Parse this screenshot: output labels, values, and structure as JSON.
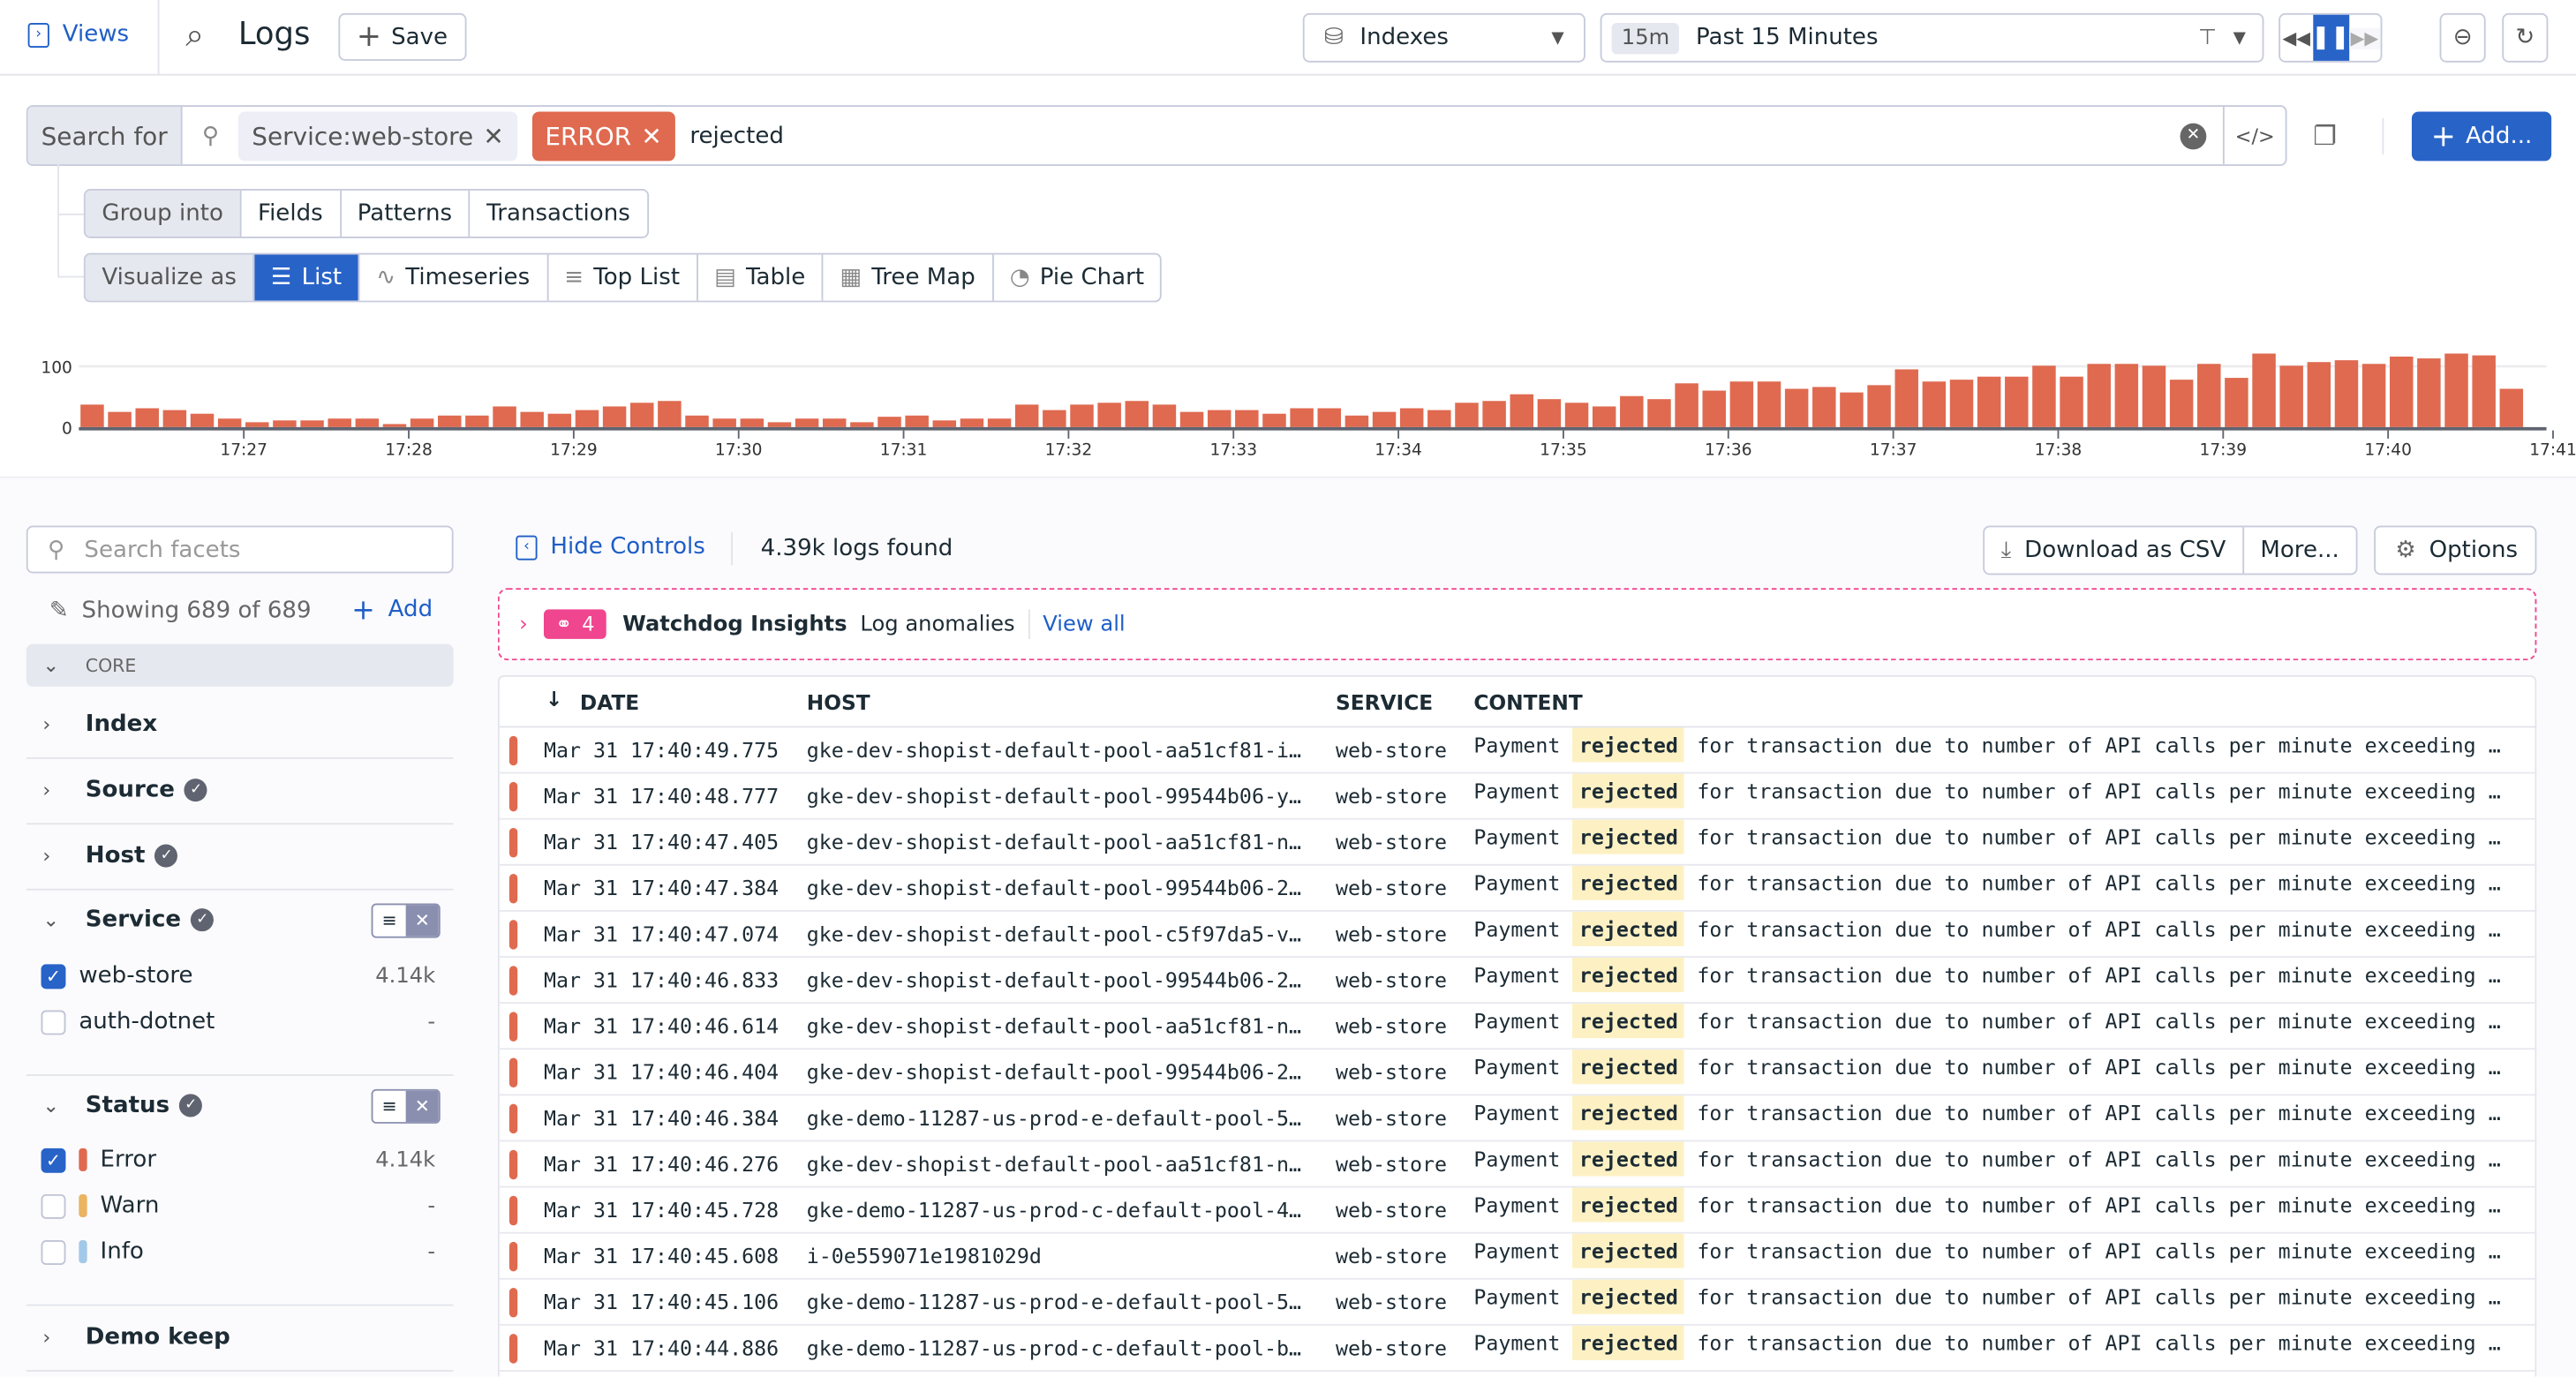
{
  "topbar": {
    "views": "Views",
    "title": "Logs",
    "save": "Save",
    "indexes": "Indexes",
    "time_badge": "15m",
    "time_range": "Past 15 Minutes"
  },
  "search": {
    "label": "Search for",
    "pills": [
      "Service:web-store",
      "ERROR"
    ],
    "query": "rejected",
    "add": "Add..."
  },
  "group": {
    "label": "Group into",
    "options": [
      "Fields",
      "Patterns",
      "Transactions"
    ]
  },
  "visualize": {
    "label": "Visualize as",
    "options": [
      "List",
      "Timeseries",
      "Top List",
      "Table",
      "Tree Map",
      "Pie Chart"
    ],
    "active": "List"
  },
  "colors": {
    "error": "#df6a50",
    "warn": "#eab461",
    "info": "#a3c9e8",
    "accent": "#2863c8",
    "watchdog": "#f0458f"
  },
  "chart_data": {
    "type": "bar",
    "ylim": [
      0,
      100
    ],
    "yticks": [
      "0",
      "100"
    ],
    "xticks": [
      "17:27",
      "17:28",
      "17:29",
      "17:30",
      "17:31",
      "17:32",
      "17:33",
      "17:34",
      "17:35",
      "17:36",
      "17:37",
      "17:38",
      "17:39",
      "17:40",
      "17:41"
    ],
    "bucket": "10s",
    "start": "17:26",
    "values": [
      37,
      25,
      31,
      28,
      22,
      14,
      8,
      11,
      11,
      14,
      14,
      5,
      14,
      19,
      19,
      34,
      25,
      22,
      28,
      34,
      40,
      43,
      19,
      14,
      14,
      8,
      14,
      14,
      8,
      17,
      19,
      11,
      14,
      14,
      37,
      28,
      37,
      40,
      43,
      37,
      25,
      28,
      28,
      22,
      31,
      31,
      19,
      25,
      31,
      28,
      40,
      43,
      54,
      46,
      40,
      34,
      51,
      46,
      72,
      60,
      75,
      75,
      63,
      66,
      57,
      69,
      95,
      75,
      78,
      83,
      83,
      101,
      83,
      104,
      104,
      101,
      78,
      104,
      81,
      121,
      101,
      107,
      110,
      104,
      116,
      113,
      121,
      118,
      63
    ]
  },
  "sidebar": {
    "search_placeholder": "Search facets",
    "showing": "Showing 689 of 689",
    "add": "Add",
    "core": "CORE",
    "facets": {
      "index": "Index",
      "source": "Source",
      "host": "Host",
      "service": "Service",
      "status": "Status",
      "demo_keep": "Demo keep"
    },
    "service_values": [
      {
        "label": "web-store",
        "count": "4.14k"
      },
      {
        "label": "auth-dotnet",
        "count": "-"
      }
    ],
    "status_values": [
      {
        "label": "Error",
        "count": "4.14k"
      },
      {
        "label": "Warn",
        "count": "-"
      },
      {
        "label": "Info",
        "count": "-"
      }
    ]
  },
  "main": {
    "hide_controls": "Hide Controls",
    "found": "4.39k logs found",
    "download": "Download as CSV",
    "more": "More...",
    "options": "Options"
  },
  "watchdog": {
    "count": "4",
    "title": "Watchdog Insights",
    "subtitle": "Log anomalies",
    "view_all": "View all"
  },
  "table": {
    "headers": [
      "DATE",
      "HOST",
      "SERVICE",
      "CONTENT"
    ],
    "content_prefix": "Payment",
    "content_highlight": "rejected",
    "content_rest": "for transaction due to number of API calls per minute exceeding …",
    "rows": [
      {
        "date": "Mar 31 17:40:49.775",
        "host": "gke-dev-shopist-default-pool-aa51cf81-i…",
        "service": "web-store"
      },
      {
        "date": "Mar 31 17:40:48.777",
        "host": "gke-dev-shopist-default-pool-99544b06-y…",
        "service": "web-store"
      },
      {
        "date": "Mar 31 17:40:47.405",
        "host": "gke-dev-shopist-default-pool-aa51cf81-n…",
        "service": "web-store"
      },
      {
        "date": "Mar 31 17:40:47.384",
        "host": "gke-dev-shopist-default-pool-99544b06-2…",
        "service": "web-store"
      },
      {
        "date": "Mar 31 17:40:47.074",
        "host": "gke-dev-shopist-default-pool-c5f97da5-v…",
        "service": "web-store"
      },
      {
        "date": "Mar 31 17:40:46.833",
        "host": "gke-dev-shopist-default-pool-99544b06-2…",
        "service": "web-store"
      },
      {
        "date": "Mar 31 17:40:46.614",
        "host": "gke-dev-shopist-default-pool-aa51cf81-n…",
        "service": "web-store"
      },
      {
        "date": "Mar 31 17:40:46.404",
        "host": "gke-dev-shopist-default-pool-99544b06-2…",
        "service": "web-store"
      },
      {
        "date": "Mar 31 17:40:46.384",
        "host": "gke-demo-11287-us-prod-e-default-pool-5…",
        "service": "web-store"
      },
      {
        "date": "Mar 31 17:40:46.276",
        "host": "gke-dev-shopist-default-pool-aa51cf81-n…",
        "service": "web-store"
      },
      {
        "date": "Mar 31 17:40:45.728",
        "host": "gke-demo-11287-us-prod-c-default-pool-4…",
        "service": "web-store"
      },
      {
        "date": "Mar 31 17:40:45.608",
        "host": "i-0e559071e1981029d",
        "service": "web-store"
      },
      {
        "date": "Mar 31 17:40:45.106",
        "host": "gke-demo-11287-us-prod-e-default-pool-5…",
        "service": "web-store"
      },
      {
        "date": "Mar 31 17:40:44.886",
        "host": "gke-demo-11287-us-prod-c-default-pool-b…",
        "service": "web-store"
      }
    ]
  }
}
